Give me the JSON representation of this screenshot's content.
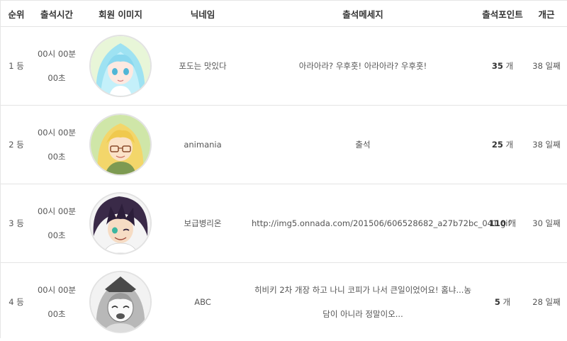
{
  "headers": {
    "rank": "순위",
    "time": "출석시간",
    "image": "회원 이미지",
    "nickname": "닉네임",
    "message": "출석메세지",
    "points": "출석포인트",
    "days": "개근"
  },
  "rows": [
    {
      "rank": "1 등",
      "time_line1": "00시 00분",
      "time_line2": "00초",
      "avatar_icon": "anime-girl-blue-hair-avatar",
      "nickname": "포도는 맛있다",
      "message": "아라아라? 우후훗! 아라아라? 우후훗!",
      "points_value": "35",
      "points_unit": " 개",
      "days": "38 일째"
    },
    {
      "rank": "2 등",
      "time_line1": "00시 00분",
      "time_line2": "00초",
      "avatar_icon": "anime-girl-blonde-glasses-avatar",
      "nickname": "animania",
      "message": "출석",
      "points_value": "25",
      "points_unit": " 개",
      "days": "38 일째"
    },
    {
      "rank": "3 등",
      "time_line1": "00시 00분",
      "time_line2": "00초",
      "avatar_icon": "anime-boy-dark-hair-avatar",
      "nickname": "보급병리온",
      "message": "http://img5.onnada.com/201506/606528682_a27b72bc_041.gif",
      "points_value": "110",
      "points_unit": " 개",
      "days": "30 일째"
    },
    {
      "rank": "4 등",
      "time_line1": "00시 00분",
      "time_line2": "00초",
      "avatar_icon": "anime-girl-monochrome-avatar",
      "nickname": "ABC",
      "message": "히비키 2차 개장 하고 나니 코피가 나서 큰일이었어요! 홈냐...농담이 아니라 정말이오...",
      "points_value": "5",
      "points_unit": " 개",
      "days": "28 일째"
    }
  ]
}
